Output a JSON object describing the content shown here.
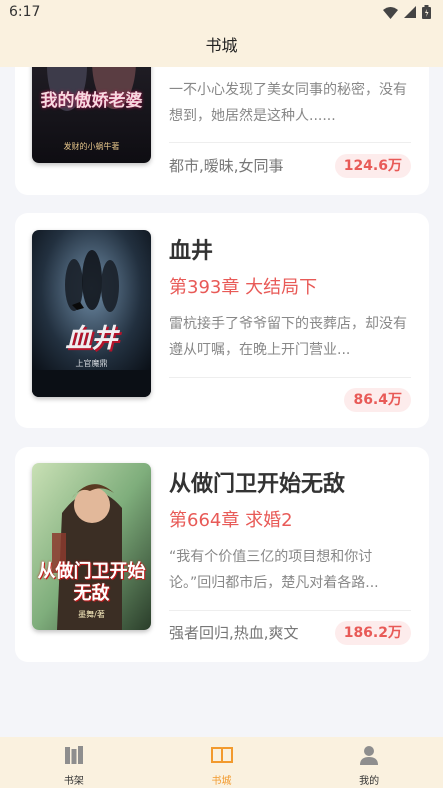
{
  "status": {
    "time": "6:17"
  },
  "header": {
    "title": "书城"
  },
  "books": [
    {
      "cover_title": "我的傲娇老婆",
      "cover_author": "发财的小蜗牛著",
      "description": "一不小心发现了美女同事的秘密，没有想到，她居然是这种人......",
      "tags": "都市,暧昧,女同事",
      "count": "124.6万"
    },
    {
      "title": "血井",
      "chapter": "第393章 大结局下",
      "cover_title": "血井",
      "cover_author": "上官魔鼎",
      "description": "雷杭接手了爷爷留下的丧葬店，却没有遵从叮嘱，在晚上开门营业...",
      "count": "86.4万"
    },
    {
      "title": "从做门卫开始无敌",
      "chapter": "第664章 求婚2",
      "cover_title": "从做门卫开始无敌",
      "cover_author": "墨舞/著",
      "description": "“我有个价值三亿的项目想和你讨论。”回归都市后，楚凡对着各路...",
      "tags": "强者回归,热血,爽文",
      "count": "186.2万"
    }
  ],
  "tabs": [
    {
      "label": "书架",
      "icon": "bookshelf-icon"
    },
    {
      "label": "书城",
      "icon": "book-open-icon",
      "active": true
    },
    {
      "label": "我的",
      "icon": "user-icon"
    }
  ],
  "colors": {
    "accent": "#f29a2e",
    "chapter": "#e85a57",
    "bar": "#faf1df"
  }
}
